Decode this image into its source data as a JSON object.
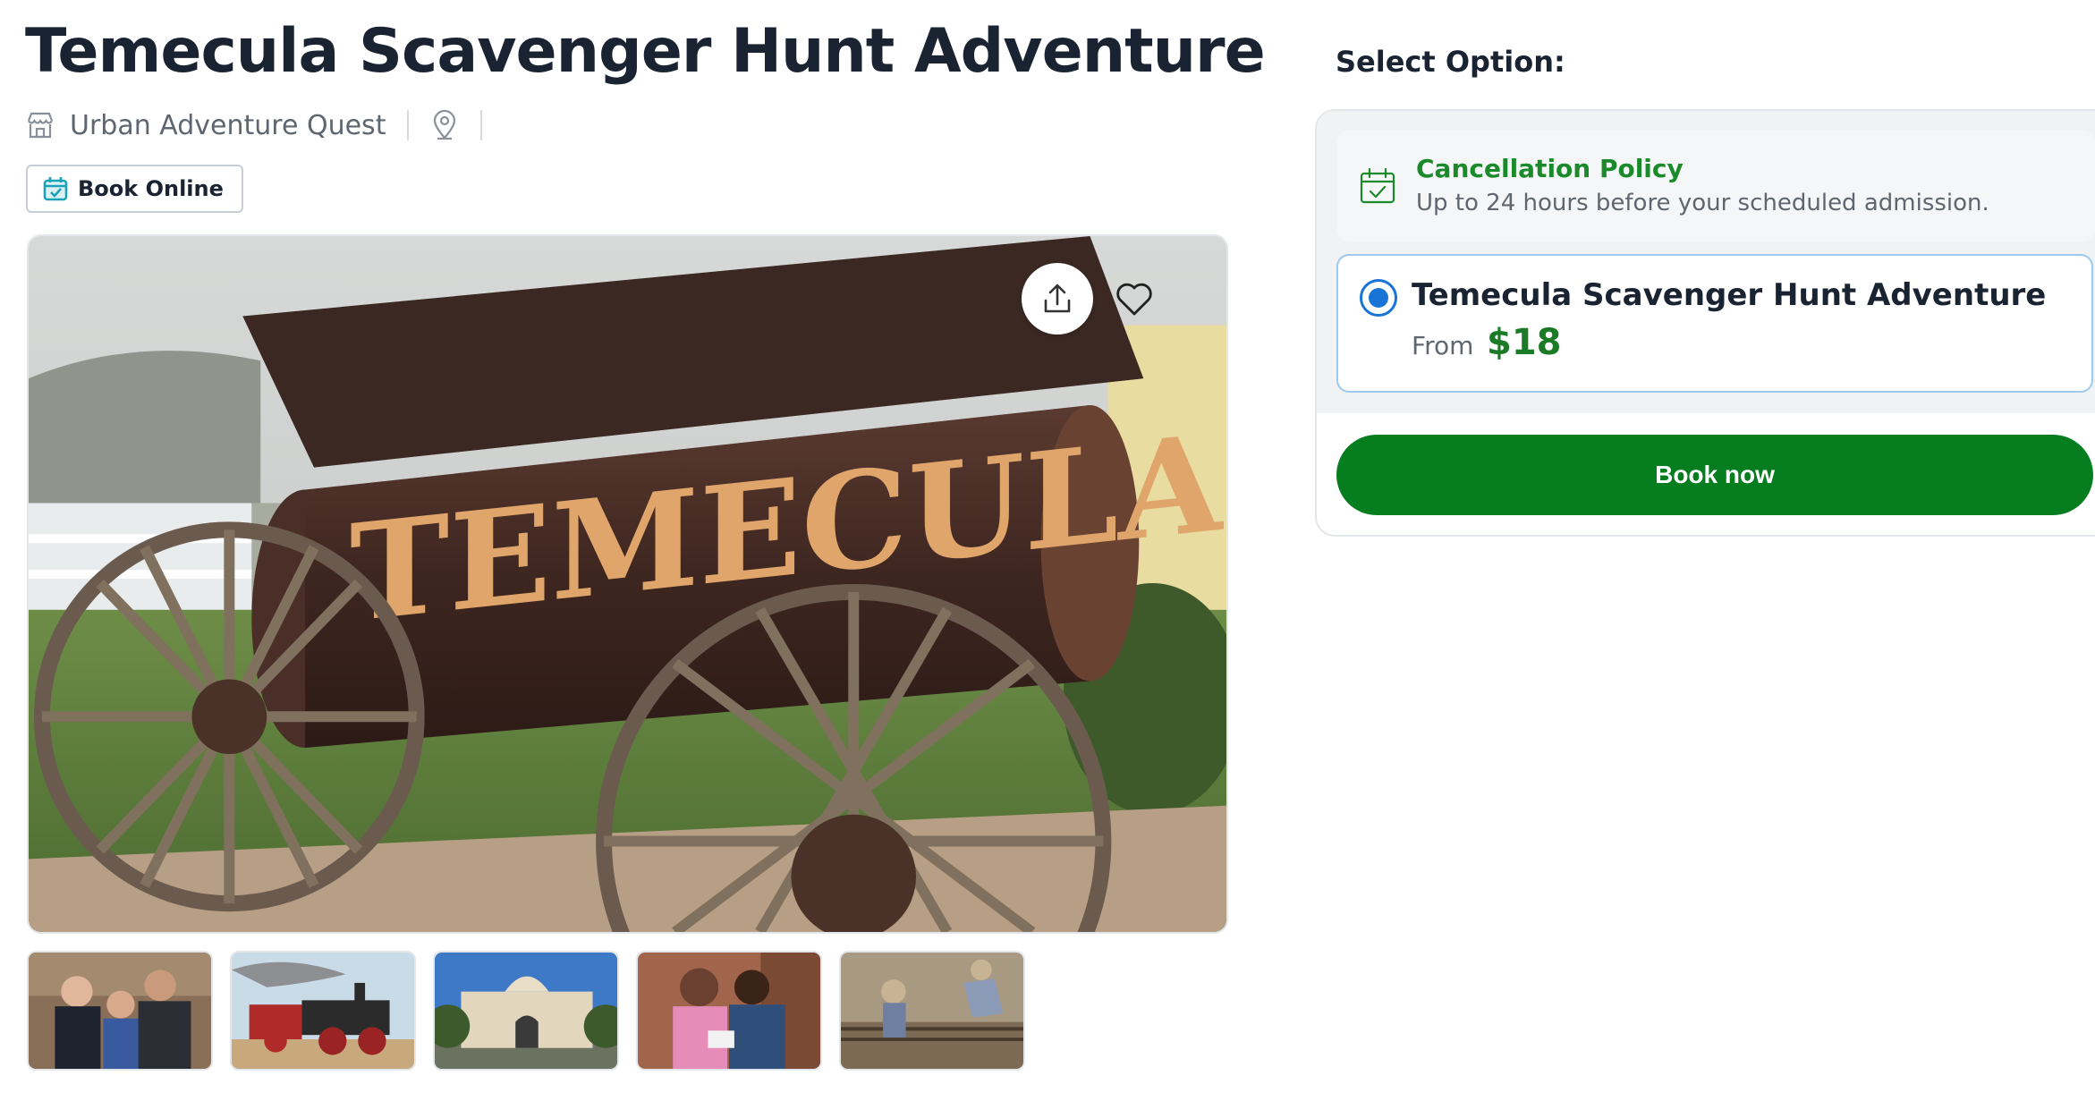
{
  "listing": {
    "title": "Temecula Scavenger Hunt Adventure",
    "vendor": "Urban Adventure Quest",
    "book_online_label": "Book Online"
  },
  "gallery": {
    "main_image": "Rusty antique water wagon with \"TEMECULA\" lettering",
    "thumbnails": [
      "family-with-phone",
      "steam-locomotive",
      "civic-building",
      "women-looking-at-phone",
      "wall-mural"
    ],
    "actions": [
      "share-icon",
      "heart-icon"
    ]
  },
  "booking": {
    "select_option_label": "Select Option:",
    "cancellation": {
      "title": "Cancellation Policy",
      "description": "Up to 24 hours before your scheduled admission."
    },
    "option": {
      "name": "Temecula Scavenger Hunt Adventure",
      "from_label": "From",
      "price": "$18",
      "selected": true
    },
    "book_now_label": "Book now"
  },
  "colors": {
    "accent_green": "#1b8a2b",
    "button_green": "#067e1f",
    "radio_blue": "#1a73d6",
    "text_dark": "#1a2332"
  }
}
